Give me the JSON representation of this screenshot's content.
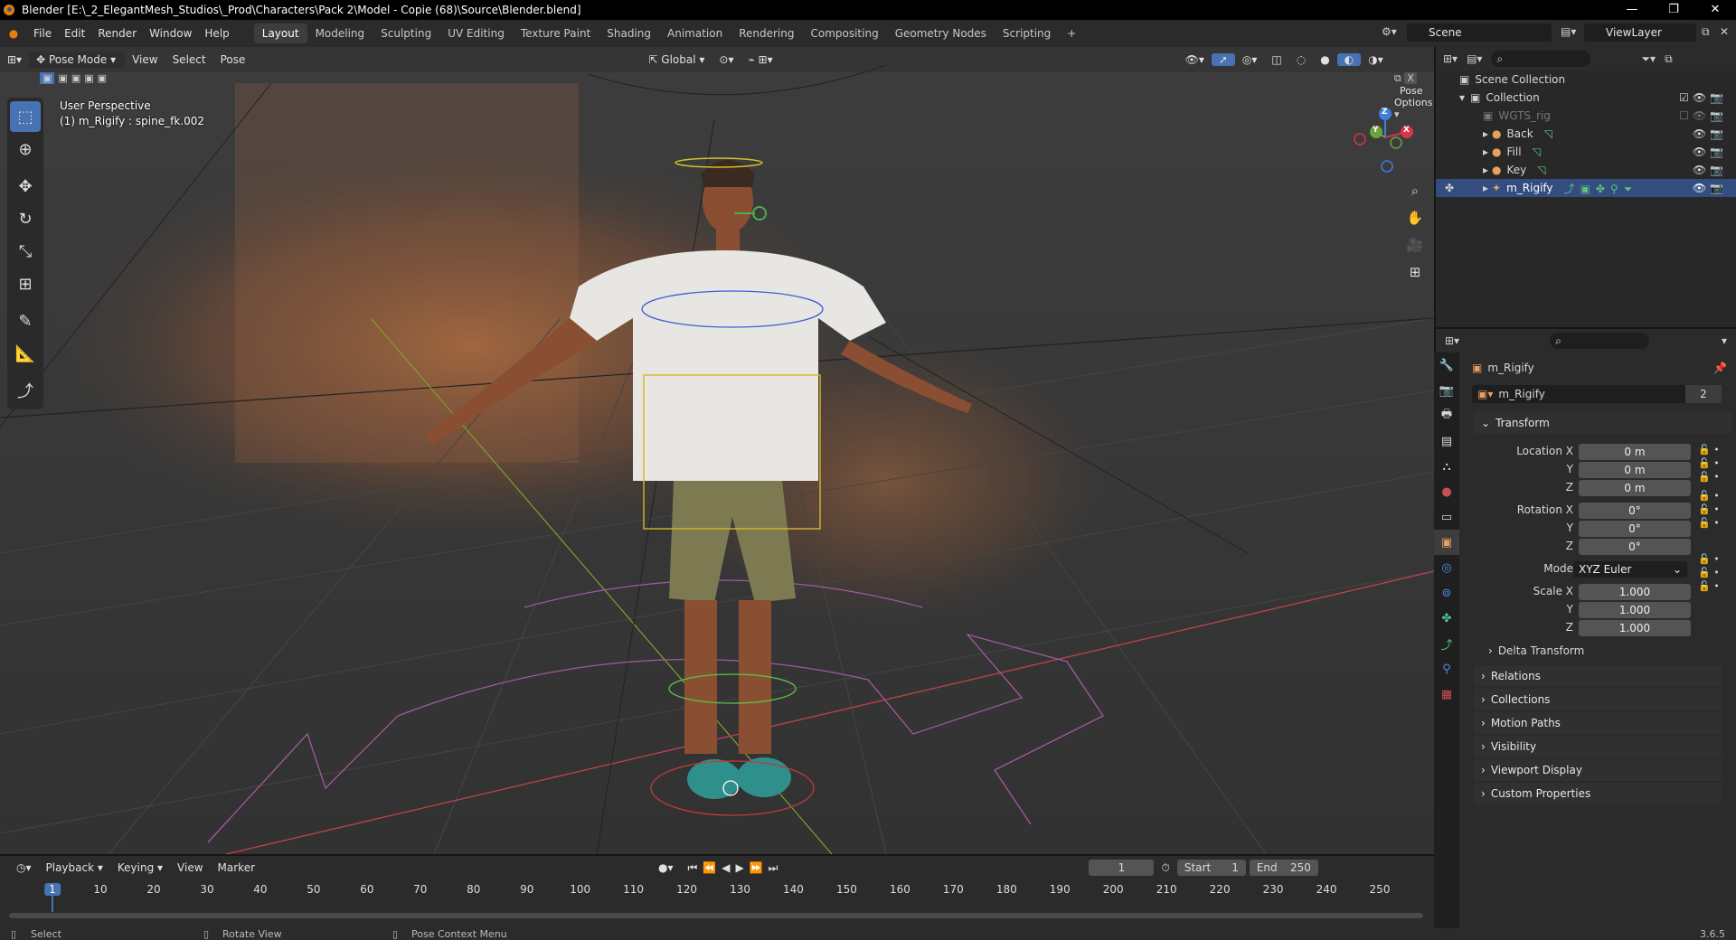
{
  "window": {
    "title": "Blender [E:\\_2_ElegantMesh_Studios\\_Prod\\Characters\\Pack 2\\Model - Copie (68)\\Source\\Blender.blend]",
    "controls": [
      "—",
      "❐",
      "✕"
    ]
  },
  "menu": {
    "items": [
      "File",
      "Edit",
      "Render",
      "Window",
      "Help"
    ]
  },
  "workspaces": [
    "Layout",
    "Modeling",
    "Sculpting",
    "UV Editing",
    "Texture Paint",
    "Shading",
    "Animation",
    "Rendering",
    "Compositing",
    "Geometry Nodes",
    "Scripting"
  ],
  "workspace_add": "+",
  "scene": {
    "name": "Scene",
    "view_layer": "ViewLayer"
  },
  "viewport": {
    "mode": "Pose Mode",
    "menus": [
      "View",
      "Select",
      "Pose"
    ],
    "transform_orientation": "Global",
    "pose_options": "Pose Options",
    "perspective": "User Perspective",
    "active": "(1) m_Rigify : spine_fk.002",
    "gizmo_axes": [
      "Z",
      "Y",
      "X"
    ]
  },
  "outliner": {
    "root": "Scene Collection",
    "collection": "Collection",
    "items": [
      {
        "name": "WGTS_rig",
        "dim": true
      },
      {
        "name": "Back"
      },
      {
        "name": "Fill"
      },
      {
        "name": "Key"
      },
      {
        "name": "m_Rigify",
        "selected": true
      }
    ]
  },
  "properties": {
    "object_name": "m_Rigify",
    "data_name": "m_Rigify",
    "users": "2",
    "transform_label": "Transform",
    "location": {
      "label": "Location X",
      "x": "0 m",
      "y": "0 m",
      "z": "0 m"
    },
    "rotation": {
      "label": "Rotation X",
      "x": "0°",
      "y": "0°",
      "z": "0°"
    },
    "mode_label": "Mode",
    "mode_value": "XYZ Euler",
    "scale": {
      "label": "Scale X",
      "x": "1.000",
      "y": "1.000",
      "z": "1.000"
    },
    "axis_y": "Y",
    "axis_z": "Z",
    "delta": "Delta Transform",
    "panels": [
      "Relations",
      "Collections",
      "Motion Paths",
      "Visibility",
      "Viewport Display",
      "Custom Properties"
    ]
  },
  "timeline": {
    "menus": [
      "Playback",
      "Keying",
      "View",
      "Marker"
    ],
    "current_frame": "1",
    "start_label": "Start",
    "start": "1",
    "end_label": "End",
    "end": "250",
    "ticks": [
      "1",
      "10",
      "20",
      "30",
      "40",
      "50",
      "60",
      "70",
      "80",
      "90",
      "100",
      "110",
      "120",
      "130",
      "140",
      "150",
      "160",
      "170",
      "180",
      "190",
      "200",
      "210",
      "220",
      "230",
      "240",
      "250"
    ]
  },
  "status": {
    "select": "Select",
    "rotate": "Rotate View",
    "context": "Pose Context Menu",
    "version": "3.6.5"
  },
  "colors": {
    "accent": "#4772b3",
    "x_axis": "#d8344a",
    "y_axis": "#6ba33a",
    "z_axis": "#3d7ee0"
  }
}
